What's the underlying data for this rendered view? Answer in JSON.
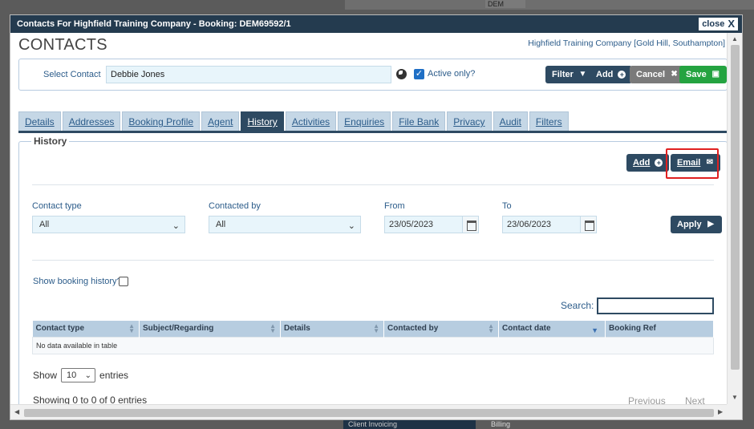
{
  "window": {
    "title": "Contacts For Highfield Training Company - Booking: DEM69592/1",
    "close_label": "close",
    "close_glyph": "X"
  },
  "background": {
    "dem_label": "DEM",
    "bottom_dark_label": "Client Invoicing",
    "bottom_text": "Billing"
  },
  "page": {
    "title": "CONTACTS",
    "company": "Highfield Training Company [Gold Hill, Southampton]"
  },
  "contact_bar": {
    "select_label": "Select Contact",
    "contact_value": "Debbie Jones",
    "active_only_label": "Active only?",
    "active_only_checked": true,
    "buttons": {
      "filter": "Filter",
      "add": "Add",
      "cancel": "Cancel",
      "save": "Save"
    }
  },
  "tabs": [
    {
      "label": "Details"
    },
    {
      "label": "Addresses"
    },
    {
      "label": "Booking Profile"
    },
    {
      "label": "Agent"
    },
    {
      "label": "History",
      "active": true
    },
    {
      "label": "Activities"
    },
    {
      "label": "Enquiries"
    },
    {
      "label": "File Bank"
    },
    {
      "label": "Privacy"
    },
    {
      "label": "Audit"
    },
    {
      "label": "Filters"
    }
  ],
  "history": {
    "legend": "History",
    "add_button": "Add",
    "email_button": "Email",
    "filters": {
      "contact_type_label": "Contact type",
      "contact_type_value": "All",
      "contacted_by_label": "Contacted by",
      "contacted_by_value": "All",
      "from_label": "From",
      "from_value": "23/05/2023",
      "to_label": "To",
      "to_value": "23/06/2023",
      "apply_button": "Apply"
    },
    "show_booking_history_label": "Show booking history?",
    "search_label": "Search:",
    "table": {
      "columns": [
        "Contact type",
        "Subject/Regarding",
        "Details",
        "Contacted by",
        "Contact date",
        "Booking Ref"
      ],
      "empty_message": "No data available in table"
    },
    "show_label": "Show",
    "page_length": "10",
    "entries_label": "entries",
    "info": "Showing 0 to 0 of 0 entries",
    "previous": "Previous",
    "next": "Next"
  },
  "colors": {
    "titlebar": "#243b4f",
    "primary_button": "#2e4a62",
    "save_button": "#24a340",
    "cancel_button": "#7a7a7a",
    "highlight": "#e02020",
    "link": "#2c5c8a"
  }
}
